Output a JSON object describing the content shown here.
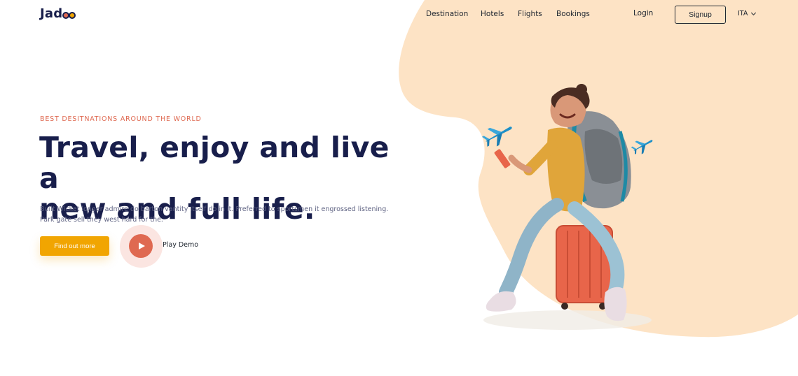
{
  "brand": {
    "logo_text": "Jad",
    "logo_suffix_letters": "oo",
    "colors": {
      "navy": "#181e4b",
      "orange": "#f1a501",
      "coral": "#df6951",
      "peach": "#fde3c5",
      "text_gray": "#5e6282"
    }
  },
  "nav": {
    "links": [
      {
        "label": "Destination"
      },
      {
        "label": "Hotels"
      },
      {
        "label": "Flights"
      },
      {
        "label": "Bookings"
      }
    ],
    "login_label": "Login",
    "signup_label": "Signup",
    "language": {
      "selected": "ITA",
      "icon": "chevron-down-icon"
    }
  },
  "hero": {
    "tagline": "BEST DESITNATIONS AROUND THE WORLD",
    "headline_line1": "Travel, enjoy and live a",
    "headline_line2": "new and full life.",
    "description": "Built Wicket longer admire do barton vantity itself do in it. Preferred to sportsmen it engrossed listening. Park gate sell they west hard for the.",
    "cta_label": "Find out more",
    "play_label": "Play Demo",
    "play_icon": "play-icon",
    "illustration": "traveler-woman-with-backpack-on-suitcase",
    "decorations": [
      "airplane-icon",
      "airplane-icon"
    ]
  }
}
